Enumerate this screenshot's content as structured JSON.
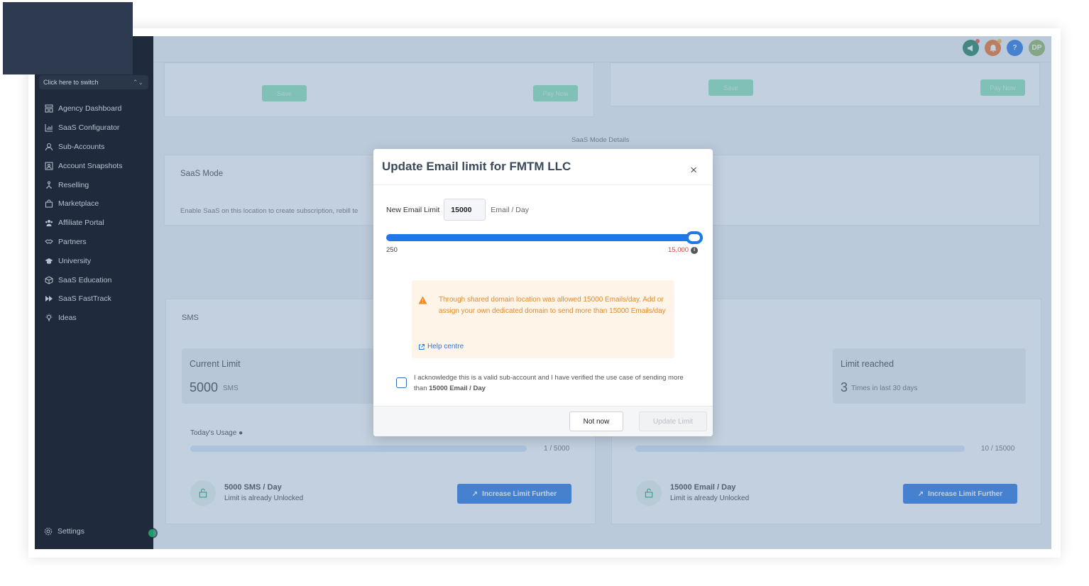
{
  "sidebar": {
    "switcher_label": "Click here to switch",
    "items": [
      {
        "label": "Agency Dashboard",
        "icon": "dashboard-icon"
      },
      {
        "label": "SaaS Configurator",
        "icon": "chart-icon"
      },
      {
        "label": "Sub-Accounts",
        "icon": "user-icon"
      },
      {
        "label": "Account Snapshots",
        "icon": "snapshot-icon"
      },
      {
        "label": "Reselling",
        "icon": "reselling-icon"
      },
      {
        "label": "Marketplace",
        "icon": "bag-icon"
      },
      {
        "label": "Affiliate Portal",
        "icon": "people-icon"
      },
      {
        "label": "Partners",
        "icon": "handshake-icon"
      },
      {
        "label": "University",
        "icon": "graduation-icon"
      },
      {
        "label": "SaaS Education",
        "icon": "cube-icon"
      },
      {
        "label": "SaaS FastTrack",
        "icon": "fastforward-icon"
      },
      {
        "label": "Ideas",
        "icon": "bulb-icon"
      }
    ],
    "settings_label": "Settings"
  },
  "topbar": {
    "avatar_initials": "DP",
    "help_glyph": "?",
    "colors": {
      "megaphone": "#1b7a52",
      "bell": "#f26a1b",
      "help": "#1d6fe0",
      "avatar": "#8fb35a"
    }
  },
  "background": {
    "save_label": "Save",
    "pay_now_label": "Pay Now",
    "saas_mode_details": "SaaS Mode Details",
    "saas_mode_title": "SaaS Mode",
    "saas_mode_desc": "Enable SaaS on this location to create subscription, rebill te",
    "sms_title": "SMS",
    "current_limit_label": "Current Limit",
    "current_limit_value": "5000",
    "current_limit_unit": "SMS",
    "limit_reached_label": "Limit reached",
    "limit_reached_value": "3",
    "limit_reached_unit": "Times in last 30 days",
    "todays_usage_label": "Today's Usage",
    "sms_usage": "1 / 5000",
    "email_usage": "10 / 15000",
    "sms_limit_title": "5000 SMS / Day",
    "email_limit_title": "15000 Email / Day",
    "unlocked_text": "Limit is already Unlocked",
    "increase_label": "Increase Limit Further"
  },
  "modal": {
    "title": "Update Email limit for FMTM LLC",
    "close_glyph": "×",
    "field_label": "New Email Limit",
    "field_value": "15000",
    "field_unit": "Email / Day",
    "slider_min": "250",
    "slider_max": "15,000",
    "slider_level": 1.0,
    "warning_text": "Through shared domain location was allowed 15000 Emails/day. Add or assign your own dedicated domain to send more than 15000 Emails/day",
    "help_label": "Help centre",
    "ack_text": "I acknowledge this is a valid sub-account and I have verified the use case of sending more than",
    "ack_bold": "15000 Email / Day",
    "not_now_label": "Not now",
    "update_label": "Update Limit"
  }
}
